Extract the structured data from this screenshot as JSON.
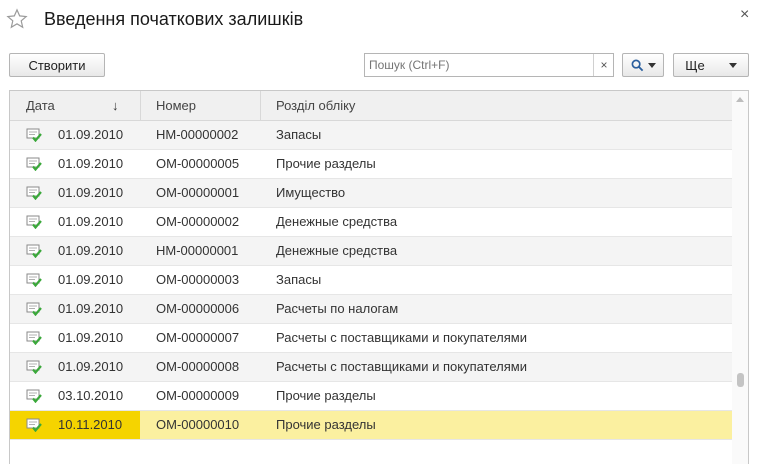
{
  "window": {
    "title": "Введення початкових залишків",
    "close_glyph": "×",
    "favorite_icon": "star-icon"
  },
  "toolbar": {
    "create_label": "Створити",
    "search_placeholder": "Пошук (Ctrl+F)",
    "search_value": "",
    "clear_glyph": "×",
    "more_label": "Ще"
  },
  "table": {
    "columns": {
      "date": "Дата",
      "number": "Номер",
      "section": "Розділ обліку"
    },
    "sort_indicator": "↓",
    "rows": [
      {
        "date": "01.09.2010",
        "number": "НМ-00000002",
        "section": "Запасы"
      },
      {
        "date": "01.09.2010",
        "number": "ОМ-00000005",
        "section": "Прочие разделы"
      },
      {
        "date": "01.09.2010",
        "number": "ОМ-00000001",
        "section": "Имущество"
      },
      {
        "date": "01.09.2010",
        "number": "ОМ-00000002",
        "section": "Денежные средства"
      },
      {
        "date": "01.09.2010",
        "number": "НМ-00000001",
        "section": "Денежные средства"
      },
      {
        "date": "01.09.2010",
        "number": "ОМ-00000003",
        "section": "Запасы"
      },
      {
        "date": "01.09.2010",
        "number": "ОМ-00000006",
        "section": "Расчеты по налогам"
      },
      {
        "date": "01.09.2010",
        "number": "ОМ-00000007",
        "section": "Расчеты с поставщиками и покупателями"
      },
      {
        "date": "01.09.2010",
        "number": "ОМ-00000008",
        "section": "Расчеты с поставщиками и покупателями"
      },
      {
        "date": "03.10.2010",
        "number": "ОМ-00000009",
        "section": "Прочие разделы"
      },
      {
        "date": "10.11.2010",
        "number": "ОМ-00000010",
        "section": "Прочие разделы"
      }
    ],
    "selected_index": 10,
    "row_icon": "posted-document-icon"
  },
  "colors": {
    "selected_row": "#fbf0a0",
    "selected_cell": "#f5d400",
    "check_green": "#3aa83a"
  }
}
